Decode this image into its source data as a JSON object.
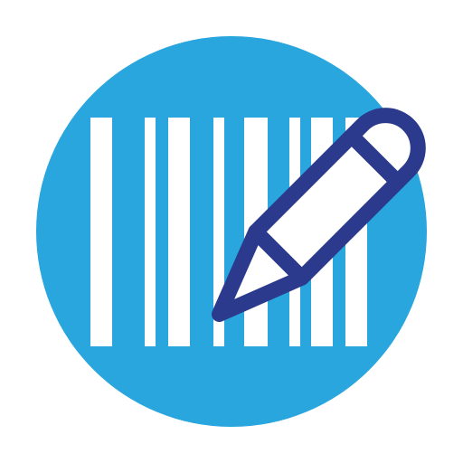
{
  "icon": {
    "name": "barcode-edit-icon",
    "colors": {
      "background": "#ffffff",
      "circle": "#2aa6de",
      "bars": "#ffffff",
      "pencil_outline": "#2b3a8c",
      "pencil_fill": "#ffffff"
    }
  }
}
